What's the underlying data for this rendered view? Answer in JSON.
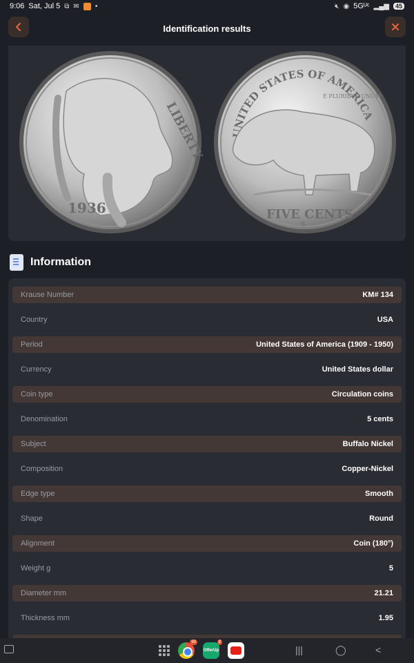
{
  "status": {
    "time": "9:06",
    "date": "Sat, Jul 5",
    "network": "5Gᵁᶜ",
    "battery": "45"
  },
  "header": {
    "title": "Identification results"
  },
  "coin": {
    "obverse_legend": "LIBERTY",
    "obverse_year": "1936",
    "reverse_legend": "UNITED STATES OF AMERICA",
    "reverse_motto": "E PLURIBUS UNUM",
    "reverse_denomination": "FIVE CENTS",
    "reverse_mintmark": "S"
  },
  "info": {
    "title": "Information",
    "rows": [
      {
        "label": "Krause Number",
        "value": "KM# 134"
      },
      {
        "label": "Country",
        "value": "USA"
      },
      {
        "label": "Period",
        "value": "United States of America (1909 - 1950)"
      },
      {
        "label": "Currency",
        "value": "United States dollar"
      },
      {
        "label": "Coin type",
        "value": "Circulation coins"
      },
      {
        "label": "Denomination",
        "value": "5 cents"
      },
      {
        "label": "Subject",
        "value": "Buffalo Nickel"
      },
      {
        "label": "Composition",
        "value": "Copper-Nickel"
      },
      {
        "label": "Edge type",
        "value": "Smooth"
      },
      {
        "label": "Shape",
        "value": "Round"
      },
      {
        "label": "Alignment",
        "value": "Coin (180°)"
      },
      {
        "label": "Weight g",
        "value": "5"
      },
      {
        "label": "Diameter mm",
        "value": "21.21"
      },
      {
        "label": "Thickness mm",
        "value": "1.95"
      },
      {
        "label": "",
        "value": ""
      }
    ]
  },
  "navbar": {
    "apps": [
      {
        "name": "Chrome",
        "badge": "99"
      },
      {
        "name": "OfferUp",
        "label": "OfferUp",
        "badge": "2"
      },
      {
        "name": "YouTube",
        "badge": ""
      }
    ]
  },
  "colors": {
    "background": "#1d1f26",
    "panel": "#292c33",
    "row_alt": "#433835",
    "accent": "#e8643c"
  }
}
